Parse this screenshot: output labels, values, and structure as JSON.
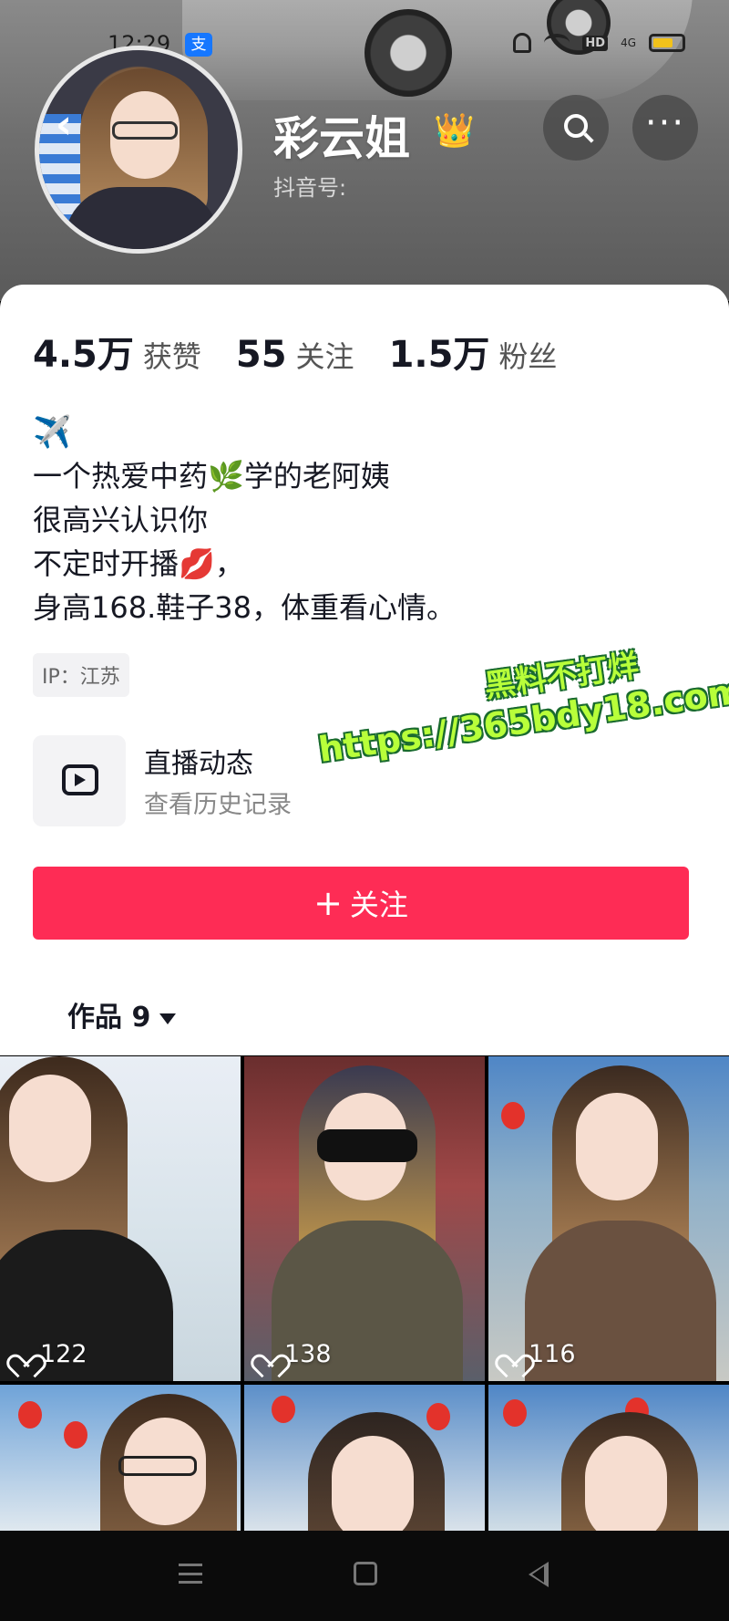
{
  "status_bar": {
    "time": "12:29",
    "alipay_badge": "支",
    "network_hd": "HD",
    "network_type": "4G"
  },
  "profile": {
    "nickname": "彩云姐",
    "crown_emoji": "👑",
    "douyin_id_label": "抖音号: ",
    "stats": [
      {
        "value": "4.5万",
        "label": "获赞"
      },
      {
        "value": "55",
        "label": "关注"
      },
      {
        "value": "1.5万",
        "label": "粉丝"
      }
    ],
    "bio": {
      "icon": "✈️",
      "line1_a": "一个热爱中药",
      "line1_emoji": "🌿",
      "line1_b": "学的老阿姨",
      "line2": "很高兴认识你",
      "line3_a": "不定时开播",
      "line3_emoji": "💋",
      "line3_b": "，",
      "line4": "身高168.鞋子38，体重看心情。"
    },
    "ip_location": "IP：江苏"
  },
  "live": {
    "title": "直播动态",
    "subtitle": "查看历史记录"
  },
  "watermark": {
    "line1": "黑料不打烊",
    "line2": "https://365bdy18.com"
  },
  "follow_button": {
    "plus": "+",
    "label": "关注"
  },
  "works_tab": {
    "label": "作品 9"
  },
  "videos": [
    {
      "likes": "122"
    },
    {
      "likes": "138"
    },
    {
      "likes": "116"
    },
    {
      "likes": ""
    },
    {
      "likes": ""
    },
    {
      "likes": ""
    }
  ],
  "colors": {
    "accent": "#fe2c55",
    "text_primary": "#161823",
    "watermark_green": "#b8ff3a"
  }
}
